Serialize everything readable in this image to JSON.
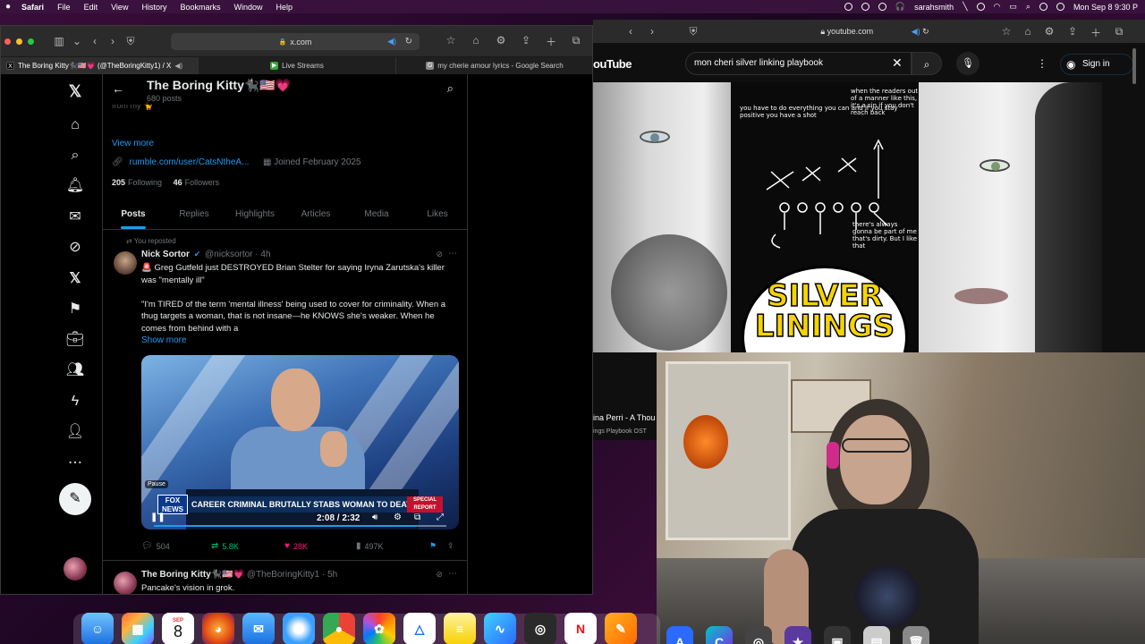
{
  "menubar": {
    "app": "Safari",
    "items": [
      "File",
      "Edit",
      "View",
      "History",
      "Bookmarks",
      "Window",
      "Help"
    ],
    "user": "sarahsmith",
    "datetime": "Mon Sep 8  9:30 P"
  },
  "safari": {
    "url": "x.com",
    "tabs": [
      {
        "label": "The Boring Kitty🐈‍⬛🇺🇸💗 (@TheBoringKitty1) / X",
        "active": true
      },
      {
        "label": "Live Streams",
        "active": false
      },
      {
        "label": "my cherie amour lyrics - Google Search",
        "active": false
      }
    ]
  },
  "profile": {
    "name": "The Boring Kitty🐈‍⬛🇺🇸💗",
    "posts_count": "680 posts",
    "bio_tail": "from my 🐈",
    "view_more": "View more",
    "link": "rumble.com/user/CatsNtheA...",
    "joined": "Joined February 2025",
    "following_count": "205",
    "following_label": "Following",
    "followers_count": "46",
    "followers_label": "Followers",
    "tabs": [
      "Posts",
      "Replies",
      "Highlights",
      "Articles",
      "Media",
      "Likes"
    ]
  },
  "tweet1": {
    "repost_label": "You reposted",
    "author": "Nick Sortor",
    "handle_time": "@nicksortor · 4h",
    "text": "🚨 Greg Gutfeld just DESTROYED Brian Stelter for saying Iryna Zarutska's killer was \"mentally ill\"\n\n\"I'm TIRED of the term 'mental illness' being used to cover for criminality. When a thug targets a woman, that is not insane—he KNOWS she's weaker. When he comes from behind with a",
    "show_more": "Show more",
    "video": {
      "chyron": "CAREER CRIMINAL BRUTALLY STABS WOMAN TO DEATH",
      "network": "FOX NEWS",
      "badge": "SPECIAL REPORT",
      "pause_label": "Pause",
      "time": "2:08 / 2:32",
      "progress": 0.9
    },
    "replies": "504",
    "reposts": "5.8K",
    "likes": "28K",
    "views": "497K"
  },
  "tweet2": {
    "author": "The Boring Kitty🐈‍⬛🇺🇸💗",
    "handle_time": "@TheBoringKitty1 · 5h",
    "text": "Pancake's vision in grok.\nPurr.Spection.\nMewnafesting."
  },
  "youtube": {
    "url": "youtube.com",
    "logo": "ouTube",
    "search_value": "mon cheri silver linking playbook",
    "signin": "Sign in",
    "poster_title": "SILVER\nLININGS",
    "poster_notes": [
      "you have to\ndo everything\nyou can and\nif you stay\npositive you\nhave a shot",
      "when the\nreaders out of\na manner like\nthis, it's a sin\nif you don't\nreach back",
      "there's always\ngonna be part of\nme that's dirty.\nBut I like that"
    ],
    "video_title": "ina Perri - A Thou",
    "video_sub": "ings Playbook OST"
  },
  "dock": {
    "calendar_month": "SEP",
    "calendar_day": "8"
  }
}
